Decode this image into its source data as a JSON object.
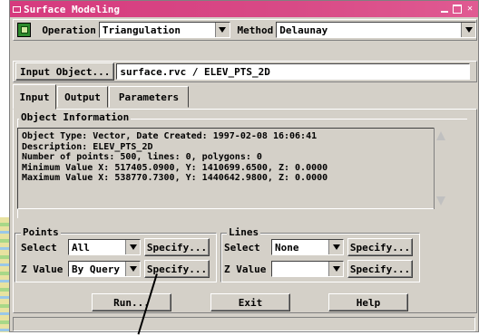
{
  "window": {
    "title": "Surface Modeling"
  },
  "toolbar": {
    "operation_label": "Operation",
    "operation_value": "Triangulation",
    "method_label": "Method",
    "method_value": "Delaunay"
  },
  "input_object": {
    "button_label": "Input Object...",
    "value": "surface.rvc / ELEV_PTS_2D"
  },
  "tabs": [
    {
      "label": "Input",
      "active": true
    },
    {
      "label": "Output",
      "active": false
    },
    {
      "label": "Parameters",
      "active": false
    }
  ],
  "object_info": {
    "legend": "Object Information",
    "lines": [
      "Object Type: Vector, Date Created: 1997-02-08 16:06:41",
      "Description: ELEV_PTS_2D",
      "Number of points: 500, lines: 0, polygons: 0",
      "Minimum Value X: 517405.0900, Y: 1410699.6500, Z: 0.0000",
      "Maximum Value X: 538770.7300, Y: 1440642.9800, Z: 0.0000"
    ]
  },
  "points": {
    "legend": "Points",
    "select_label": "Select",
    "select_value": "All",
    "select_specify": "Specify...",
    "z_label": "Z Value",
    "z_value": "By Query",
    "z_specify": "Specify..."
  },
  "lines": {
    "legend": "Lines",
    "select_label": "Select",
    "select_value": "None",
    "select_specify": "Specify...",
    "z_label": "Z Value",
    "z_value": "",
    "z_specify": "Specify..."
  },
  "actions": {
    "run": "Run...",
    "exit": "Exit",
    "help": "Help"
  },
  "colors": {
    "titlebar": "#d63a7e",
    "window_bg": "#d4d0c8"
  }
}
